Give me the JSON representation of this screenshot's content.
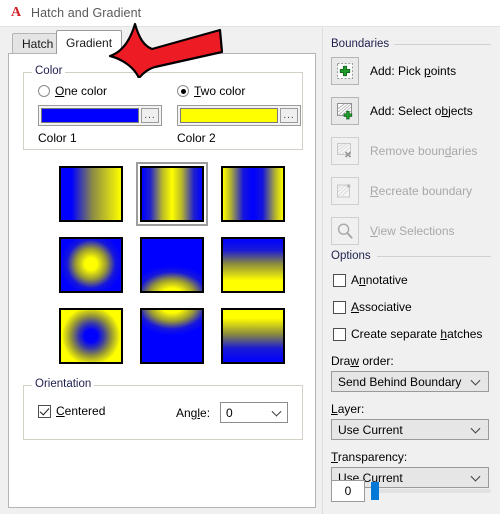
{
  "window": {
    "title": "Hatch and Gradient",
    "logo_icon": "autocad-a-icon",
    "logo_glyph": "A"
  },
  "tabs": [
    {
      "label": "Hatch",
      "active": false
    },
    {
      "label": "Gradient",
      "active": true
    }
  ],
  "color_group": {
    "legend": "Color",
    "one_color": {
      "label_pre": "",
      "label_underlined": "O",
      "label_post": "ne color",
      "selected": false
    },
    "two_color": {
      "label_pre": "",
      "label_underlined": "T",
      "label_post": "wo color",
      "selected": true
    },
    "color1": {
      "label": "Color 1",
      "value": "#0000FF",
      "browse_label": "..."
    },
    "color2": {
      "label": "Color 2",
      "value": "#FFFF00",
      "browse_label": "..."
    }
  },
  "gradient_patterns": {
    "selected_index": 1,
    "color_start": "#0000FF",
    "color_end": "#FFFF00",
    "items": [
      {
        "name": "linear-horizontal",
        "css": "linear-gradient(to right, #0000ff 0%, #0000ff 18%, #8a8a46 52%, #ffff00 100%)"
      },
      {
        "name": "linear-horizontal-centered",
        "css": "linear-gradient(to right, #0000ff 0%, #2222cc 14%, #b9b92a 34%, #ffff00 50%, #b9b92a 66%, #2222cc 86%, #0000ff 100%)"
      },
      {
        "name": "linear-horizontal-inverted",
        "css": "linear-gradient(to right, #ffff00 0%, #b9b92a 12%, #1414dd 34%, #0000ff 50%, #1414dd 66%, #b9b92a 88%, #ffff00 100%)"
      },
      {
        "name": "radial-yellow-center",
        "css": "radial-gradient(circle at 50% 48%, #ffff00 0%, #ffff00 15%, #9a9a33 38%, #1515dd 60%, #0000ff 78%)"
      },
      {
        "name": "curved-spherical-up",
        "css": "radial-gradient(ellipse 78% 62% at 50% 108%, #ffff00 0%, #ffff00 22%, #9a9a33 48%, #1717db 72%, #0000ff 92%)"
      },
      {
        "name": "linear-vertical-up",
        "css": "linear-gradient(to top, #ffff00 0%, #ffff00 20%, #8c8c3c 52%, #1a1ad6 78%, #0000ff 100%)"
      },
      {
        "name": "radial-blue-center",
        "css": "radial-gradient(circle at 50% 50%, #0000ff 0%, #0000ff 16%, #3a3aa8 32%, #9a9a33 52%, #ffff00 74%)"
      },
      {
        "name": "curved-spherical-down",
        "css": "radial-gradient(ellipse 78% 62% at 50% -8%, #ffff00 0%, #ffff00 22%, #9a9a33 48%, #1717db 72%, #0000ff 92%)"
      },
      {
        "name": "linear-vertical-down",
        "css": "linear-gradient(to bottom, #ffff00 0%, #ffff00 16%, #8c8c3c 46%, #1a1ad6 74%, #0000ff 100%)"
      }
    ]
  },
  "orientation_group": {
    "legend": "Orientation",
    "centered": {
      "label_underlined": "C",
      "label_post": "entered",
      "checked": true
    },
    "angle": {
      "label_pre": "Ang",
      "label_underlined": "l",
      "label_post": "e:",
      "value": "0"
    }
  },
  "boundaries": {
    "title": "Boundaries",
    "items": [
      {
        "label_pre": "Add: Pick ",
        "label_underlined": "p",
        "label_post": "oints",
        "icon": "pick-points-icon",
        "enabled": true
      },
      {
        "label_pre": "Add: Select o",
        "label_underlined": "b",
        "label_post": "jects",
        "icon": "select-objects-icon",
        "enabled": true
      },
      {
        "label_pre": "Remove boun",
        "label_underlined": "d",
        "label_post": "aries",
        "icon": "remove-boundaries-icon",
        "enabled": false
      },
      {
        "label_pre": "",
        "label_underlined": "R",
        "label_post": "ecreate boundary",
        "icon": "recreate-boundary-icon",
        "enabled": false
      },
      {
        "label_pre": "",
        "label_underlined": "V",
        "label_post": "iew Selections",
        "icon": "view-selections-icon",
        "enabled": false
      }
    ]
  },
  "options": {
    "title": "Options",
    "items": [
      {
        "label_pre": "A",
        "label_underlined": "n",
        "label_post": "notative",
        "checked": false
      },
      {
        "label_pre": "",
        "label_underlined": "A",
        "label_post": "ssociative",
        "checked": false
      },
      {
        "label_pre": "Create separate ",
        "label_underlined": "h",
        "label_post": "atches",
        "checked": false
      }
    ],
    "draw_order": {
      "label_pre": "Dra",
      "label_underlined": "w",
      "label_post": " order:",
      "value": "Send Behind Boundary"
    },
    "layer": {
      "label_pre": "",
      "label_underlined": "L",
      "label_post": "ayer:",
      "value": "Use Current"
    },
    "transparency": {
      "label_pre": "",
      "label_underlined": "T",
      "label_post": "ransparency:",
      "value": "Use Current",
      "amount": "0",
      "slider_percent": 0
    }
  },
  "annotation": {
    "arrow": {
      "name": "red-pointer-arrow",
      "color": "#ED1C24",
      "direction": "left"
    }
  }
}
